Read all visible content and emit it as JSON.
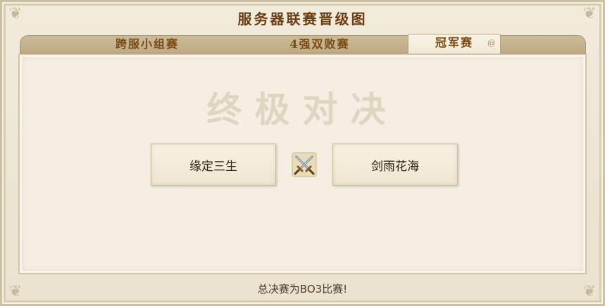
{
  "title": "服务器联赛晋级图",
  "tabs": [
    {
      "label": "跨服小组赛",
      "active": false
    },
    {
      "label": "4强双败赛",
      "active": false
    },
    {
      "label": "冠军赛",
      "active": true
    }
  ],
  "watermark": "终极对决",
  "match": {
    "team_left": "缘定三生",
    "team_right": "剑雨花海",
    "versus_icon": "crossed-swords-icon"
  },
  "footer": "总决赛为BO3比赛!"
}
